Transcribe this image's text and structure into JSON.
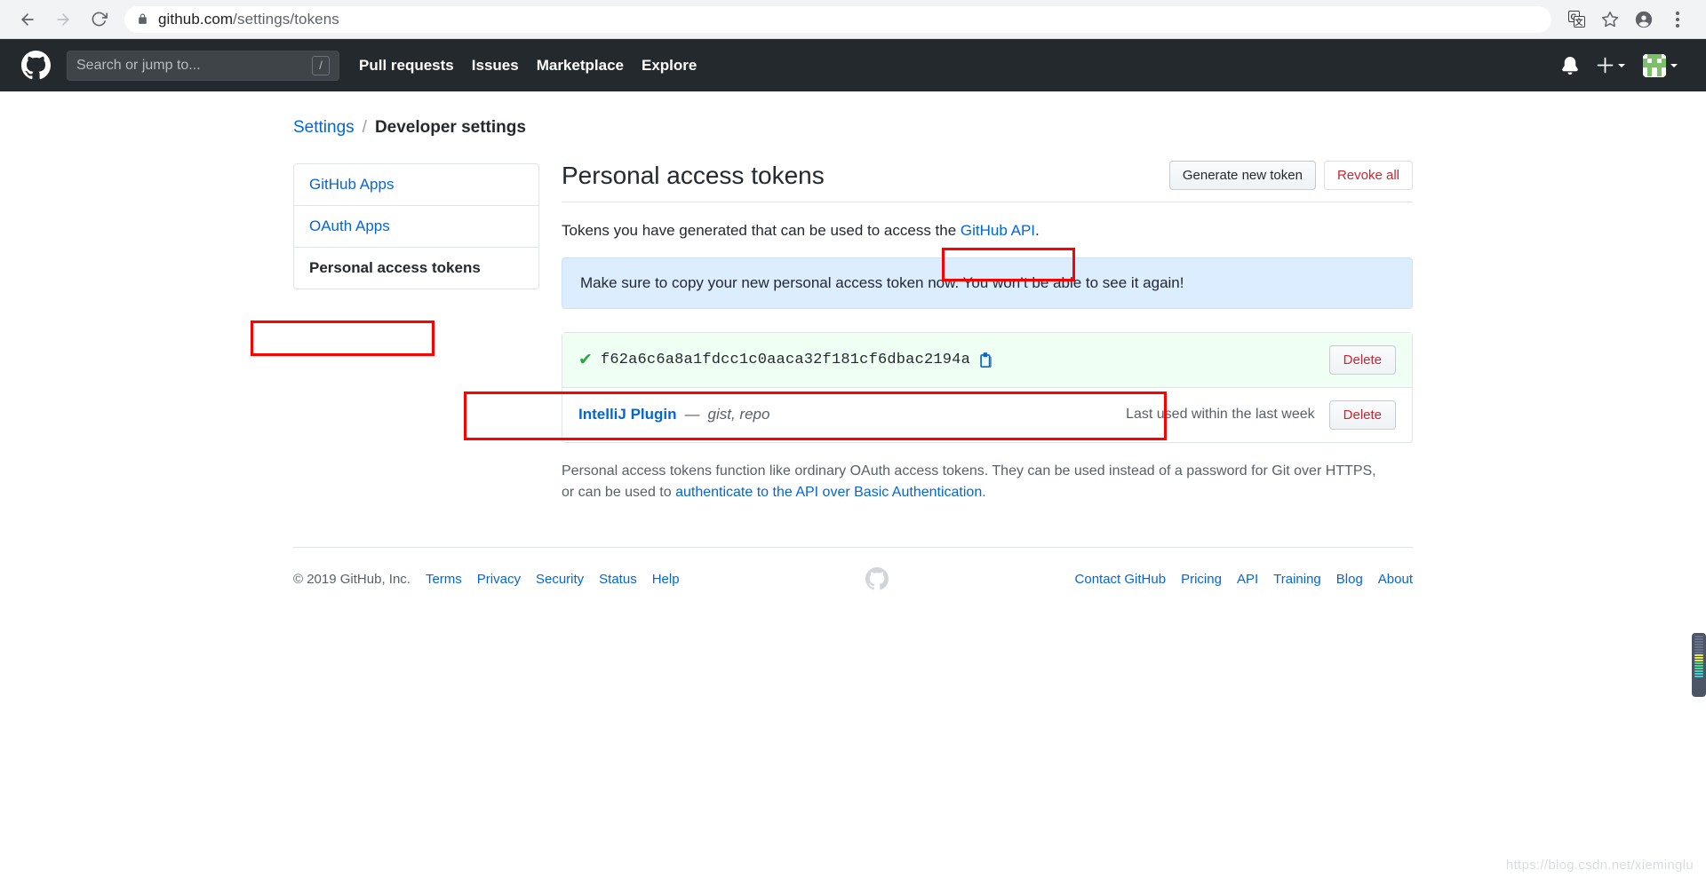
{
  "browser": {
    "back_icon": "back-arrow-icon",
    "forward_icon": "forward-arrow-icon",
    "reload_icon": "reload-icon",
    "lock_icon": "lock-icon",
    "url_domain": "github.com",
    "url_path": "/settings/tokens",
    "translate_icon": "translate-icon",
    "bookmark_icon": "star-icon",
    "profile_icon": "profile-avatar-icon",
    "menu_icon": "three-dot-menu-icon"
  },
  "gh_header": {
    "logo_icon": "github-octocat-icon",
    "search_placeholder": "Search or jump to...",
    "search_value": "",
    "slash_hint": "/",
    "nav": [
      {
        "label": "Pull requests"
      },
      {
        "label": "Issues"
      },
      {
        "label": "Marketplace"
      },
      {
        "label": "Explore"
      }
    ],
    "notification_icon": "bell-icon",
    "create_new_icon": "plus-icon",
    "avatar_icon": "user-avatar-icon"
  },
  "breadcrumb": {
    "settings": "Settings",
    "separator": "/",
    "current": "Developer settings"
  },
  "sidebar": {
    "items": [
      {
        "label": "GitHub Apps",
        "selected": false
      },
      {
        "label": "OAuth Apps",
        "selected": false
      },
      {
        "label": "Personal access tokens",
        "selected": true
      }
    ]
  },
  "main": {
    "title": "Personal access tokens",
    "generate_button": "Generate new token",
    "revoke_button": "Revoke all",
    "intro_before": "Tokens you have generated that can be used to access the ",
    "intro_link": "GitHub API",
    "intro_after": ".",
    "flash_message": "Make sure to copy your new personal access token now. You won’t be able to see it again!",
    "new_token": {
      "check_icon": "green-check-icon",
      "value": "f62a6c6a8a1fdcc1c0aaca32f181cf6dbac2194a",
      "copy_icon": "clipboard-copy-icon",
      "delete_button": "Delete"
    },
    "existing_token": {
      "name": "IntelliJ Plugin",
      "dash": "—",
      "scopes": "gist, repo",
      "last_used": "Last used within the last week",
      "delete_button": "Delete"
    },
    "note_before": "Personal access tokens function like ordinary OAuth access tokens. They can be used instead of a password for Git over HTTPS, or can be used to ",
    "note_link": "authenticate to the API over Basic Authentication",
    "note_after": "."
  },
  "footer": {
    "copyright": "© 2019 GitHub, Inc.",
    "left_links": [
      {
        "label": "Terms"
      },
      {
        "label": "Privacy"
      },
      {
        "label": "Security"
      },
      {
        "label": "Status"
      },
      {
        "label": "Help"
      }
    ],
    "mark_icon": "github-octocat-icon",
    "right_links": [
      {
        "label": "Contact GitHub"
      },
      {
        "label": "Pricing"
      },
      {
        "label": "API"
      },
      {
        "label": "Training"
      },
      {
        "label": "Blog"
      },
      {
        "label": "About"
      }
    ]
  },
  "overlay": {
    "watermark": "https://blog.csdn.net/xieminglu"
  },
  "colors": {
    "annotation": "#ff0000",
    "github_dark": "#24292e",
    "link_blue": "#0366d6",
    "danger_red": "#cb2431",
    "success_green": "#28a745",
    "flash_blue_bg": "#dbedff",
    "new_token_bg": "#f0fff4"
  }
}
